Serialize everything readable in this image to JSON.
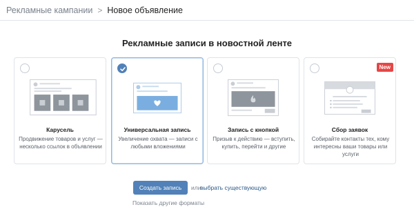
{
  "breadcrumb": {
    "parent": "Рекламные кампании",
    "separator": ">",
    "current": "Новое объявление"
  },
  "section_title": "Рекламные записи в новостной ленте",
  "cards": [
    {
      "title": "Карусель",
      "description": "Продвижение товаров и услуг — несколько ссылок в объявлении",
      "selected": false,
      "badge": ""
    },
    {
      "title": "Универсальная запись",
      "description": "Увеличение охвата — записи с любыми вложениями",
      "selected": true,
      "badge": ""
    },
    {
      "title": "Запись с кнопкой",
      "description": "Призыв к действию — вступить, купить, перейти и другие",
      "selected": false,
      "badge": ""
    },
    {
      "title": "Сбор заявок",
      "description": "Собирайте контакты тех, кому интересны ваши товары или услуги",
      "selected": false,
      "badge": "New"
    }
  ],
  "actions": {
    "create_label": "Создать запись",
    "or_text": "или",
    "choose_existing": "выбрать существующую",
    "other_formats": "Показать другие форматы"
  },
  "colors": {
    "accent": "#5181b8",
    "link": "#2a5885",
    "badge": "#e64646"
  }
}
